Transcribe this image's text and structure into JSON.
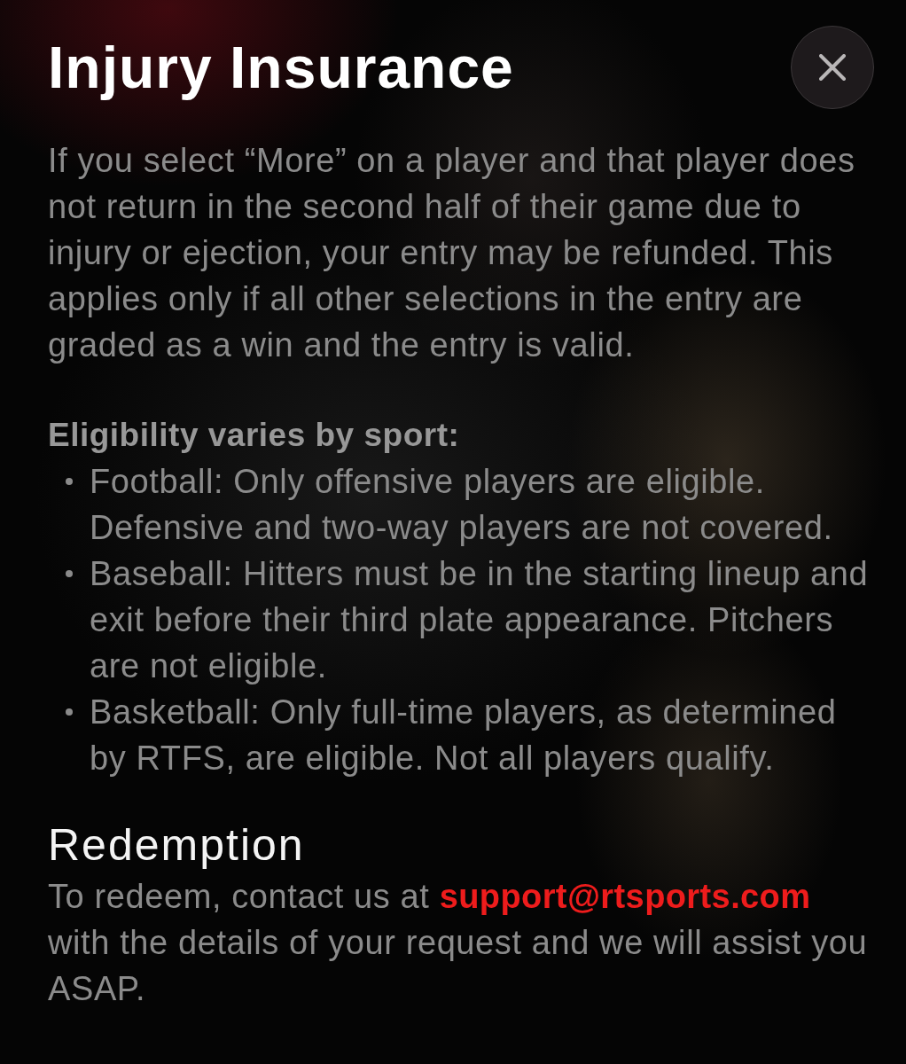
{
  "header": {
    "title": "Injury Insurance"
  },
  "intro": "If you select “More” on a player and that player does not return in the second half of their game due to injury or ejection, your entry may be refunded. This applies only if all other selections in the entry are graded as a win and the entry is valid.",
  "eligibility": {
    "heading": "Eligibility varies by sport:",
    "items": [
      "Football: Only offensive players are eligible. Defensive and two-way players are not covered.",
      "Baseball: Hitters must be in the starting lineup and exit before their third plate appearance. Pitchers are not eligible.",
      "Basketball: Only full-time players, as determined by RTFS, are eligible. Not all players qualify."
    ]
  },
  "redemption": {
    "heading": "Redemption",
    "text_before": "To redeem, contact us at",
    "link": "support@rtsports.com",
    "text_after": "with the details of your request and we will assist you ASAP."
  }
}
